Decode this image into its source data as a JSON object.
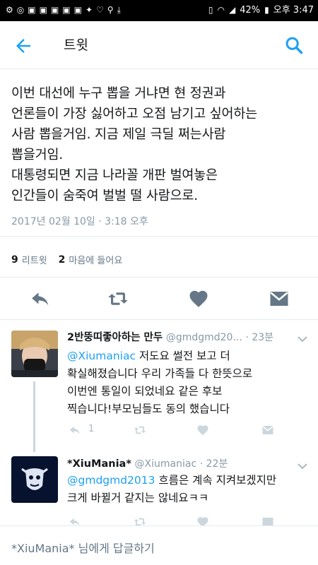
{
  "status_bar": {
    "battery": "42%",
    "time": "오후 3:47",
    "icons": [
      "settings-icon",
      "instagram-icon",
      "message-icon",
      "message-icon",
      "message-icon",
      "message-icon",
      "message-icon",
      "twitter-icon",
      "heart-icon",
      "usb-icon",
      "download-icon",
      "vibrate-icon",
      "wifi-icon",
      "signal-icon",
      "battery-icon"
    ]
  },
  "app_bar": {
    "title": "트윗",
    "back_icon": "back-arrow-icon",
    "search_icon": "search-icon"
  },
  "tweet": {
    "text": "이번 대선에 누구 뽑을 거냐면 현 정권과\n언론들이 가장 싫어하고 오점 남기고 싶어하는\n사람 뽑을거임. 지금 제일 극딜 쩌는사람\n뽑을거임.\n대통령되면 지금 나라꼴 개판 벌여놓은\n인간들이 숨죽여 벌벌 떨 사람으로.",
    "timestamp": "2017년 02월 10일 · 3:18 오후",
    "retweet_count": "9",
    "retweet_label": "리트윗",
    "like_count": "2",
    "like_label": "마음에 들어요"
  },
  "colors": {
    "accent": "#1da1f2",
    "text": "#14171a",
    "muted": "#8899a6",
    "icon": "#657786"
  },
  "replies": [
    {
      "name": "2반뚱띠좋아하는 만두",
      "handle": "@gmdgmd20...",
      "time": "· 23분",
      "mention": "@Xiumaniac",
      "text_first": " 저도요 썰전 보고 더",
      "text_rest": "확실해졌습니다 우리 가족들 다 한뜻으로\n이번엔 통일이 되었네요 같은 후보\n찍습니다!부모님들도 동의 했습니다",
      "reply_count": "1"
    },
    {
      "name": "*XiuMania*",
      "handle": "@Xiumaniac",
      "time": "· 22분",
      "mention": "@gmdgmd2013",
      "text_first": " 흐름은 계속 지켜보겠지만",
      "text_rest": "크게 바뀔거 같지는 않네요ㅋㅋ",
      "reply_count": ""
    }
  ],
  "reply_bar": {
    "placeholder": "*XiuMania* 님에게 답글하기"
  }
}
